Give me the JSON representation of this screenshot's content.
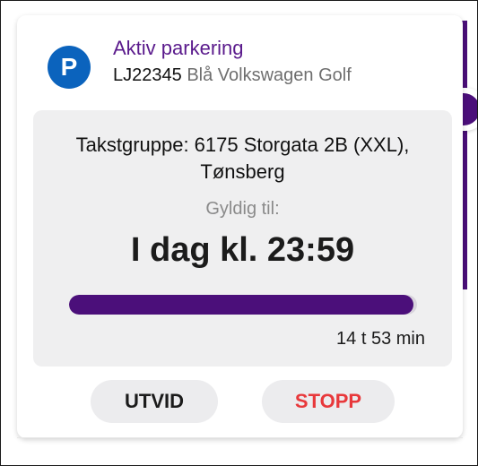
{
  "parking": {
    "logo_letter": "P",
    "title": "Aktiv parkering",
    "plate": "LJ22345",
    "vehicle": "Blå Volkswagen Golf",
    "zone": "Takstgruppe: 6175 Storgata 2B (XXL), Tønsberg",
    "valid_label": "Gyldig til:",
    "valid_time": "I dag kl. 23:59",
    "progress_fraction": 0.99,
    "remaining": "14 t 53 min"
  },
  "actions": {
    "extend_label": "UTVID",
    "stop_label": "STOPP"
  },
  "colors": {
    "accent": "#4b0f7a",
    "logo_blue": "#0b63bd",
    "stop_red": "#e8383b"
  }
}
